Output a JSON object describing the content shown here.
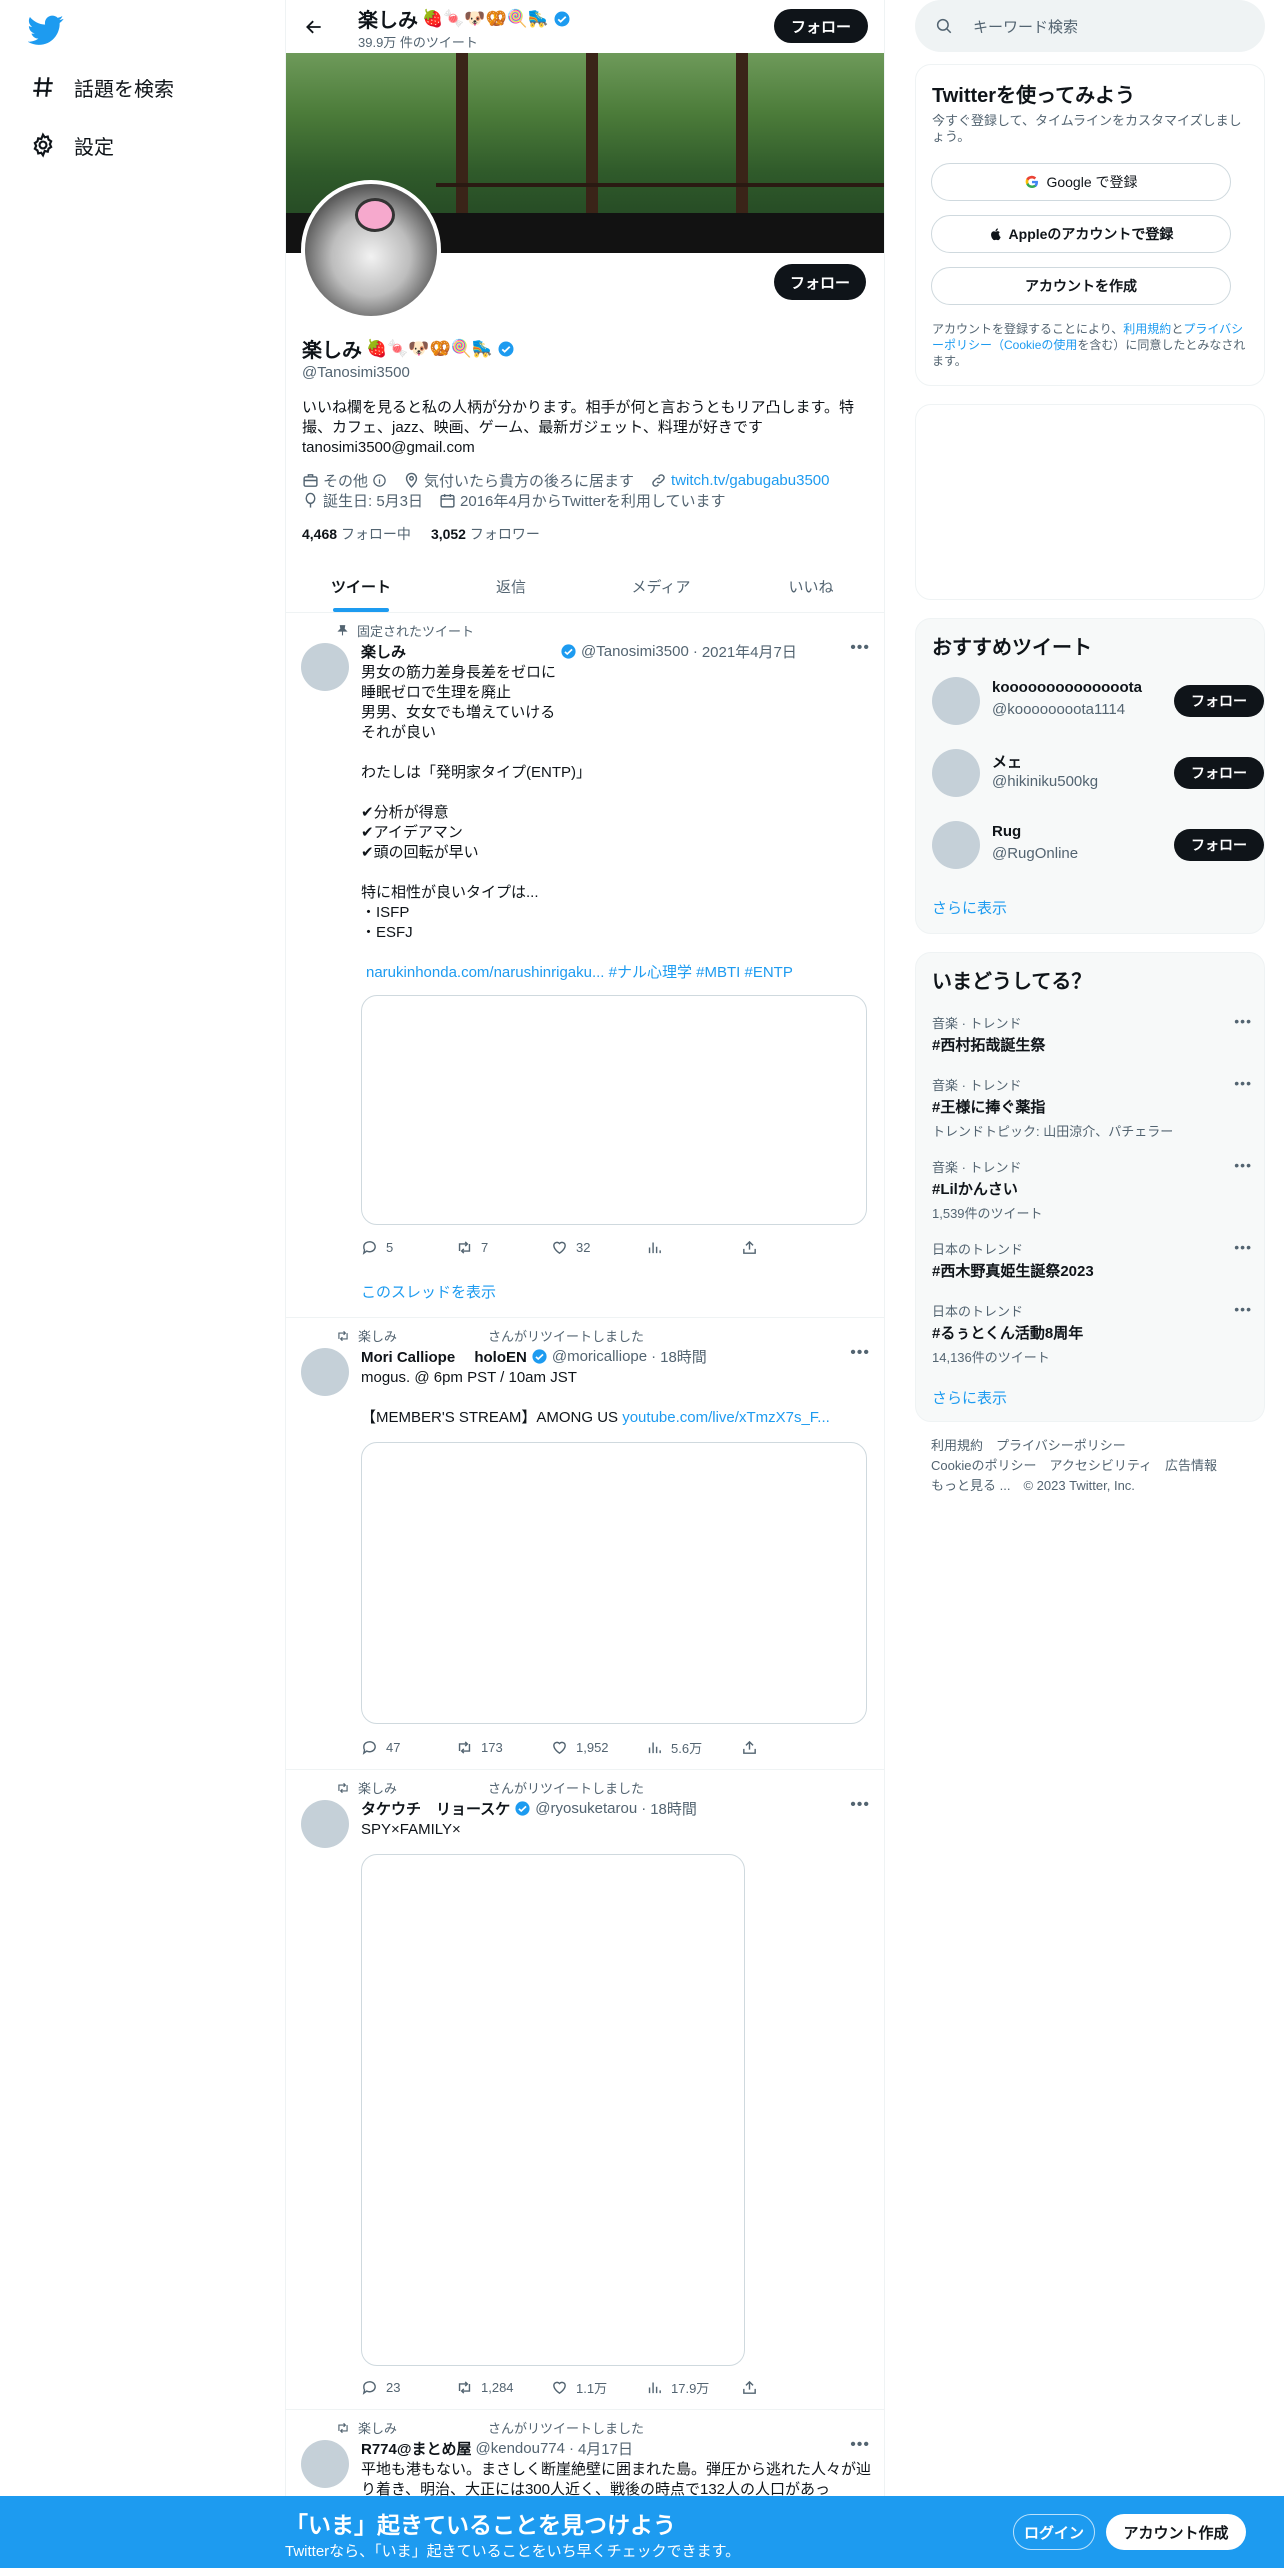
{
  "nav": {
    "explore_label": "話題を検索",
    "settings_label": "設定"
  },
  "header": {
    "name": "楽しみ",
    "emoji": "🍓🍬🐶🥨🍭🛼",
    "tweet_count": "39.9万 件のツイート",
    "follow_label": "フォロー"
  },
  "profile": {
    "name": "楽しみ",
    "emoji": "🍓🍬🐶🥨🍭🛼",
    "handle": "@Tanosimi3500",
    "follow_label": "フォロー",
    "bio": "いいね欄を見ると私の人柄が分かります。相手が何と言おうともリア凸します。特撮、カフェ、jazz、映画、ゲーム、最新ガジェット、料理が好きです\ntanosimi3500@gmail.com",
    "category": "その他",
    "location": "気付いたら貴方の後ろに居ます",
    "url": "twitch.tv/gabugabu3500",
    "birthday": "誕生日: 5月3日",
    "joined": "2016年4月からTwitterを利用しています",
    "following_count": "4,468",
    "following_label": "フォロー中",
    "followers_count": "3,052",
    "followers_label": "フォロワー"
  },
  "tabs": [
    "ツイート",
    "返信",
    "メディア",
    "いいね"
  ],
  "tweets": [
    {
      "context": "固定されたツイート",
      "name": "楽しみ",
      "handle": "@Tanosimi3500",
      "date": "2021年4月7日",
      "text": "男女の筋力差身長差をゼロに\n睡眠ゼロで生理を廃止\n男男、女女でも増えていける\nそれが良い\n\nわたしは「発明家タイプ(ENTP)」\n\n✔分析が得意\n✔アイデアマン\n✔頭の回転が早い\n\n特に相性が良いタイプは...\n・ISFP\n・ESFJ",
      "links": "narukinhonda.com/narushinrigaku... #ナル心理学 #MBTI #ENTP",
      "replies": "5",
      "retweets": "7",
      "likes": "32",
      "show_thread": "このスレッドを表示"
    },
    {
      "context": "楽しみ　　　　　　　さんがリツイートしました",
      "name": "Mori Calliope　 holoEN",
      "handle": "@moricalliope",
      "date": "18時間",
      "text": "mogus. @ 6pm PST / 10am JST\n\n【MEMBER'S STREAM】AMONG US ",
      "link": "youtube.com/live/xTmzX7s_F...",
      "replies": "47",
      "retweets": "173",
      "likes": "1,952",
      "views": "5.6万"
    },
    {
      "context": "楽しみ　　　　　　　さんがリツイートしました",
      "name": "タケウチ　リョースケ",
      "handle": "@ryosuketarou",
      "date": "18時間",
      "text": "SPY×FAMILY×",
      "replies": "23",
      "retweets": "1,284",
      "likes": "1.1万",
      "views": "17.9万"
    },
    {
      "context": "楽しみ　　　　　　　さんがリツイートしました",
      "name": "R774@まとめ屋",
      "handle": "@kendou774",
      "date": "4月17日",
      "text": "平地も港もない。まさしく断崖絶壁に囲まれた島。弾圧から逃れた人々が辿り着き、明治、大正には300人近く、戦後の時点で132人の人口があっ"
    }
  ],
  "search": {
    "placeholder": "キーワード検索"
  },
  "signup": {
    "title": "Twitterを使ってみよう",
    "subtitle": "今すぐ登録して、タイムラインをカスタマイズしましょう。",
    "google": "Google で登録",
    "apple": "Appleのアカウントで登録",
    "create": "アカウントを作成",
    "legal_1": "アカウントを登録することにより、",
    "legal_terms": "利用規約",
    "legal_and": "と",
    "legal_privacy": "プライバシーポリシー",
    "legal_cookie": "（Cookieの使用",
    "legal_2": "を含む）に同意したとみなされます。"
  },
  "recommended": {
    "title": "おすすめツイート",
    "users": [
      {
        "name": "koooooooooooooota",
        "handle": "@koooooooota1114",
        "button": "フォロー"
      },
      {
        "name": "メェ",
        "handle": "@hikiniku500kg",
        "button": "フォロー"
      },
      {
        "name": "Rug",
        "handle": "@RugOnline",
        "button": "フォロー"
      }
    ],
    "show_more": "さらに表示"
  },
  "trends": {
    "title": "いまどうしてる？",
    "items": [
      {
        "category": "音楽 · トレンド",
        "title": "#西村拓哉誕生祭",
        "extra": ""
      },
      {
        "category": "音楽 · トレンド",
        "title": "#王様に捧ぐ薬指",
        "extra": "トレンドトピック: 山田涼介、パチェラー"
      },
      {
        "category": "音楽 · トレンド",
        "title": "#Lilかんさい",
        "extra": "1,539件のツイート"
      },
      {
        "category": "日本のトレンド",
        "title": "#西木野真姫生誕祭2023",
        "extra": ""
      },
      {
        "category": "日本のトレンド",
        "title": "#るぅとくん活動8周年",
        "extra": "14,136件のツイート"
      }
    ],
    "show_more": "さらに表示"
  },
  "footer": {
    "line1": "利用規約　プライバシーポリシー",
    "line2": "Cookieのポリシー　アクセシビリティ　広告情報",
    "line3": "もっと見る ...　© 2023 Twitter, Inc."
  },
  "bottom": {
    "title": "「いま」起きていることを見つけよう",
    "subtitle": "Twitterなら、「いま」起きていることをいち早くチェックできます。",
    "login": "ログイン",
    "signup": "アカウント作成"
  },
  "colors": {
    "accent": "#1d9bf0",
    "text": "#0f1419",
    "muted": "#536471"
  }
}
